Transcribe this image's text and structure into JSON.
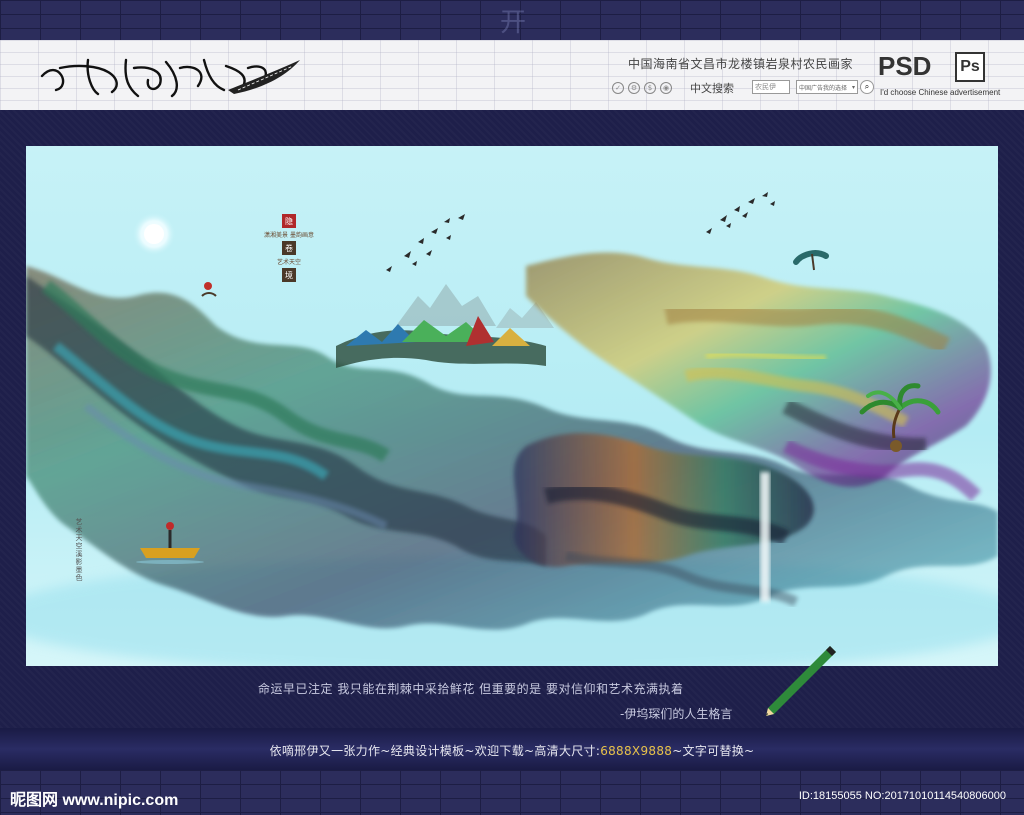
{
  "header": {
    "watermark_glyphs": "开",
    "title_line": "中国海南省文昌市龙楼镇岩泉村农民画家",
    "psd_label": "PSD",
    "ps_badge": "Ps",
    "english_line": "I'd choose Chinese advertisement",
    "search": {
      "label": "中文搜索",
      "input_value": "农民伊",
      "select_value": "中国广告我的选择"
    }
  },
  "artwork": {
    "seal_top": "隐",
    "caption_1": "潇湘美景 墨韵画意",
    "seal_middle": "卷",
    "caption_2": "艺术天空",
    "seal_bottom": "境",
    "side_column": "艺术天空溪影墨色"
  },
  "quote": {
    "line": "命运早已注定  我只能在荆棘中采拾鲜花  但重要的是  要对信仰和艺术充满执着",
    "author": "-伊坞琛们的人生格言"
  },
  "banner": {
    "text_before": "依嘀邢伊又一张力作~经典设计模板~欢迎下载~高清大尺寸:",
    "size_highlight": "6888X9888",
    "text_after": "~文字可替换~"
  },
  "footer": {
    "site_logo": "昵图网 www.nipic.com",
    "id_line": "ID:18155055 NO:20171010114540806000"
  },
  "colors": {
    "frame": "#1e1f4a",
    "banner": "#2a2c64",
    "highlight": "#e8c24a",
    "sky": "#bff0f6"
  }
}
